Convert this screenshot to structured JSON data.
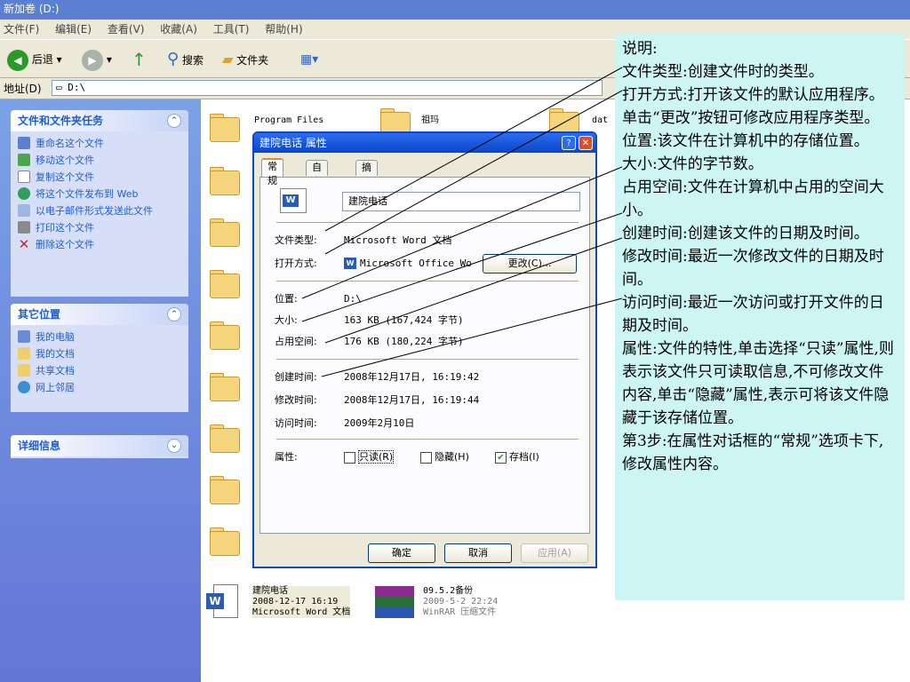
{
  "window": {
    "title": "新加卷 (D:)"
  },
  "menu": [
    "文件(F)",
    "编辑(E)",
    "查看(V)",
    "收藏(A)",
    "工具(T)",
    "帮助(H)"
  ],
  "toolbar": {
    "back": "后退",
    "search": "搜索",
    "folders": "文件夹"
  },
  "address": {
    "label": "地址(D)",
    "value": "D:\\"
  },
  "tasks": {
    "file_tasks": {
      "title": "文件和文件夹任务",
      "items": [
        "重命名这个文件",
        "移动这个文件",
        "复制这个文件",
        "将这个文件发布到 Web",
        "以电子邮件形式发送此文件",
        "打印这个文件",
        "删除这个文件"
      ]
    },
    "other_places": {
      "title": "其它位置",
      "items": [
        "我的电脑",
        "我的文档",
        "共享文档",
        "网上邻居"
      ]
    },
    "details": {
      "title": "详细信息"
    }
  },
  "files": {
    "f1": "Program Files",
    "f2": "祖玛",
    "f3": "dat",
    "doc": {
      "name": "建院电话",
      "date": "2008-12-17 16:19",
      "type": "Microsoft Word 文档"
    },
    "rar": {
      "name": "09.5.2备份",
      "date": "2009-5-2 22:24",
      "type": "WinRAR 压缩文件"
    }
  },
  "dialog": {
    "title": "建院电话 属性",
    "tabs": [
      "常规",
      "自定义",
      "摘要"
    ],
    "filename": "建院电话",
    "labels": {
      "type": "文件类型:",
      "open": "打开方式:",
      "loc": "位置:",
      "size": "大小:",
      "disk": "占用空间:",
      "created": "创建时间:",
      "modified": "修改时间:",
      "accessed": "访问时间:",
      "attr": "属性:"
    },
    "values": {
      "type": "Microsoft Word 文档",
      "open": "Microsoft Office Wo",
      "loc": "D:\\",
      "size": "163 KB (167,424 字节)",
      "disk": "176 KB (180,224 字节)",
      "created": "2008年12月17日, 16:19:42",
      "modified": "2008年12月17日, 16:19:44",
      "accessed": "2009年2月10日"
    },
    "change_btn": "更改(C)...",
    "attrs": {
      "readonly": "只读(R)",
      "hidden": "隐藏(H)",
      "archive": "存档(I)"
    },
    "buttons": {
      "ok": "确定",
      "cancel": "取消",
      "apply": "应用(A)"
    }
  },
  "note": [
    "说明:",
    "文件类型:创建文件时的类型。",
    "打开方式:打开该文件的默认应用程序。单击“更改”按钮可修改应用程序类型。",
    "位置:该文件在计算机中的存储位置。",
    "大小:文件的字节数。",
    "占用空间:文件在计算机中占用的空间大小。",
    "创建时间:创建该文件的日期及时间。",
    "修改时间:最近一次修改文件的日期及时间。",
    "访问时间:最近一次访问或打开文件的日期及时间。",
    "属性:文件的特性,单击选择“只读”属性,则表示该文件只可读取信息,不可修改文件内容,单击“隐藏”属性,表示可将该文件隐藏于该存储位置。",
    "第3步:在属性对话框的“常规”选项卡下,修改属性内容。"
  ]
}
